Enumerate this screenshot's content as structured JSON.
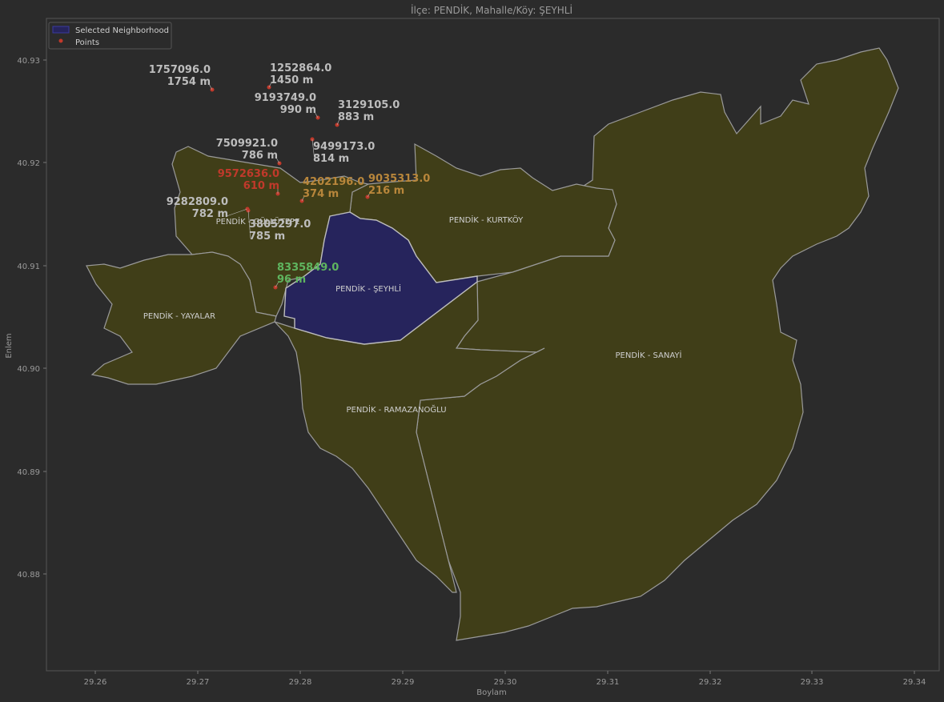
{
  "title": "İlçe: PENDİK, Mahalle/Köy: ŞEYHLİ",
  "xlabel": "Boylam",
  "ylabel": "Enlem",
  "x_ticks": [
    "29.26",
    "29.27",
    "29.28",
    "29.29",
    "29.30",
    "29.31",
    "29.32",
    "29.33",
    "29.34"
  ],
  "y_ticks": [
    "40.93",
    "40.92",
    "40.91",
    "40.90",
    "40.89",
    "40.88"
  ],
  "legend": {
    "selected": "Selected Neighborhood",
    "points": "Points"
  },
  "colors": {
    "background": "#2b2b2b",
    "neighborhood_fill": "#403e18",
    "selected_fill": "#26245c",
    "boundary": "#9a9a9a",
    "point": "#c0392b",
    "label_default": "#bdbdbd",
    "label_red": "#c0392b",
    "label_orange": "#b8863b",
    "label_green": "#5fb55f"
  },
  "regions": [
    {
      "name": "PENDİK - YAYALAR"
    },
    {
      "name": "PENDİK - GÜLLÜTEPE"
    },
    {
      "name": "PENDİK - ŞEYHLİ"
    },
    {
      "name": "PENDİK - KURTKÖY"
    },
    {
      "name": "PENDİK - SANAYİ"
    },
    {
      "name": "PENDİK - RAMAZANOĞLU"
    }
  ],
  "points": [
    {
      "id": "1757096.0",
      "dist": "1754 m",
      "color": "label_default"
    },
    {
      "id": "1252864.0",
      "dist": "1450 m",
      "color": "label_default"
    },
    {
      "id": "9193749.0",
      "dist": "990 m",
      "color": "label_default"
    },
    {
      "id": "3129105.0",
      "dist": "883 m",
      "color": "label_default"
    },
    {
      "id": "7509921.0",
      "dist": "786 m",
      "color": "label_default"
    },
    {
      "id": "9499173.0",
      "dist": "814 m",
      "color": "label_default"
    },
    {
      "id": "9572636.0",
      "dist": "610 m",
      "color": "label_red"
    },
    {
      "id": "4202196.0",
      "dist": "374 m",
      "color": "label_orange"
    },
    {
      "id": "9035313.0",
      "dist": "216 m",
      "color": "label_orange"
    },
    {
      "id": "9282809.0",
      "dist": "782 m",
      "color": "label_default"
    },
    {
      "id": "3805297.0",
      "dist": "785 m",
      "color": "label_default"
    },
    {
      "id": "8335849.0",
      "dist": "96 m",
      "color": "label_green"
    }
  ]
}
